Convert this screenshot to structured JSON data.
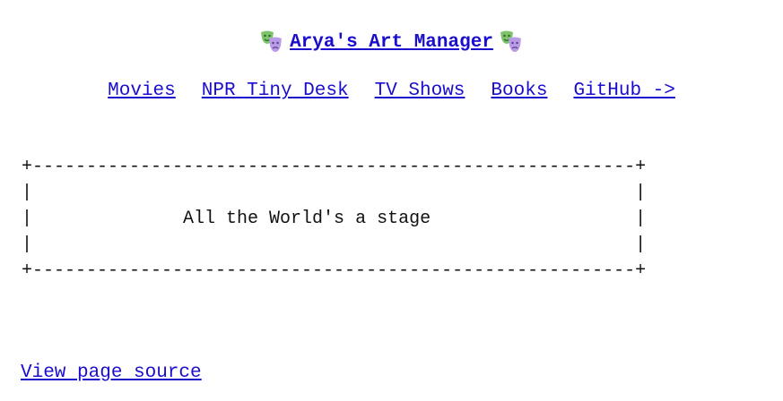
{
  "header": {
    "title": "Arya's Art Manager",
    "icon_left": "theater-masks-icon",
    "icon_right": "theater-masks-icon"
  },
  "nav": {
    "items": [
      {
        "label": "Movies"
      },
      {
        "label": "NPR Tiny Desk"
      },
      {
        "label": "TV Shows"
      },
      {
        "label": "Books"
      },
      {
        "label": "GitHub ->"
      }
    ]
  },
  "banner": {
    "text": "All the World's a stage"
  },
  "footer": {
    "view_source_label": "View page source"
  },
  "colors": {
    "link": "#1a0dcc",
    "text": "#111111",
    "mask_green": "#7dc36b",
    "mask_purple": "#b99ce6"
  }
}
